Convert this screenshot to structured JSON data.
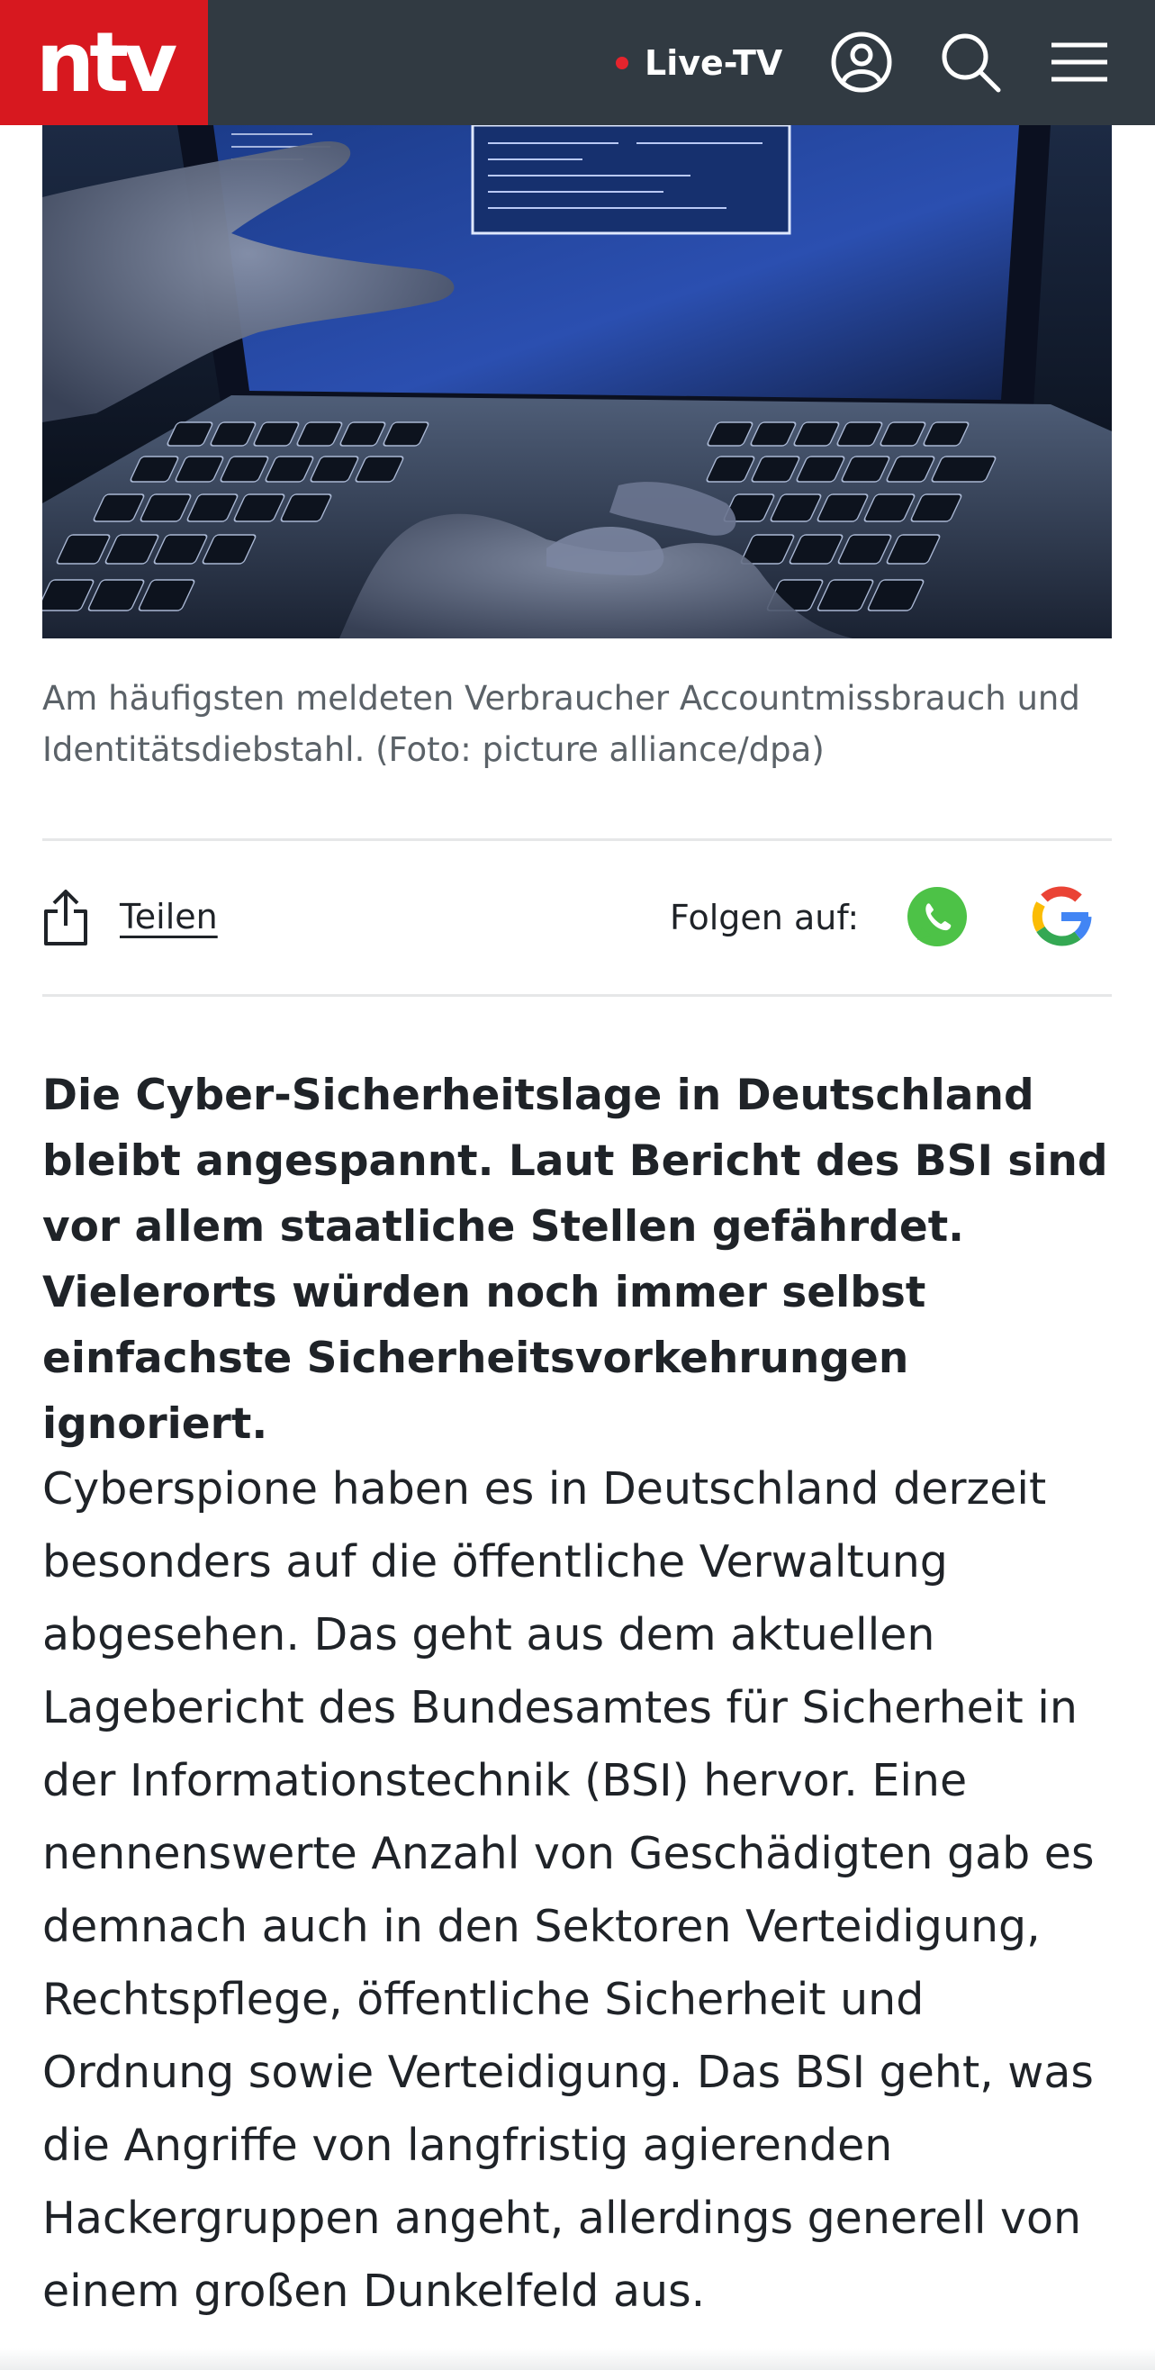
{
  "header": {
    "logo_text": "ntv",
    "live_label": "Live-TV",
    "icons": [
      "account-icon",
      "search-icon",
      "menu-icon"
    ],
    "brand_red": "#d7181f",
    "bar_color": "#313a42"
  },
  "article": {
    "image_caption": "Am häufigsten meldeten Verbraucher Accountmissbrauch und Identitätsdiebstahl. (Foto: picture alliance/dpa)",
    "share_label": "Teilen",
    "follow_label": "Folgen auf:",
    "follow_icons": [
      "whatsapp-icon",
      "google-icon"
    ],
    "lead": "Die Cyber-Sicherheitslage in Deutschland bleibt angespannt. Laut Bericht des BSI sind vor allem staatliche Stellen gefährdet. Vielerorts würden noch immer selbst einfachste Sicherheitsvorkehrungen ignoriert.",
    "body": "Cyberspione haben es in Deutschland derzeit besonders auf die öffentliche Verwaltung abgesehen. Das geht aus dem aktuellen Lagebericht des Bundesamtes für Sicherheit in der Informationstechnik (BSI) hervor. Eine nennenswerte Anzahl von Geschädigten gab es demnach auch in den Sektoren Verteidigung, Rechtspflege, öffentliche Sicherheit und Ordnung sowie Verteidigung. Das BSI geht, was die Angriffe von langfristig agierenden Hackergruppen angeht, allerdings generell von einem großen Dunkelfeld aus."
  }
}
